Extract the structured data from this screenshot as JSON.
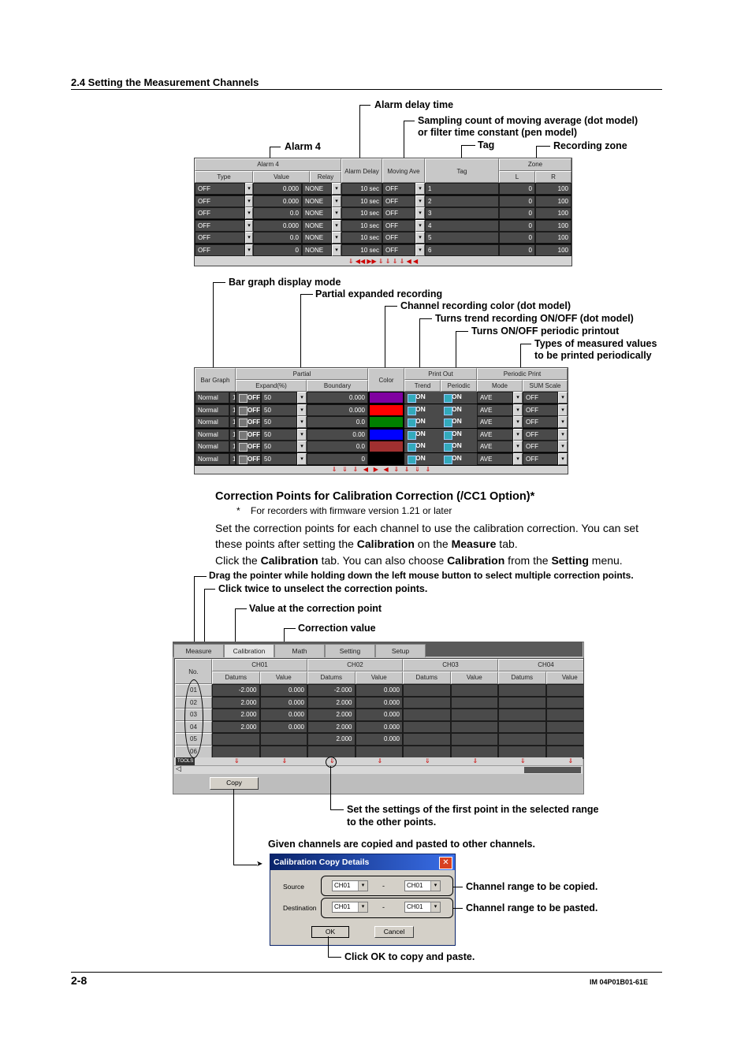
{
  "header": {
    "section": "2.4  Setting the Measurement Channels"
  },
  "fig1": {
    "labels": {
      "alarm_delay": "Alarm delay time",
      "sampling1": "Sampling count of moving average (dot model)",
      "sampling2": "or filter time constant (pen model)",
      "tag": "Tag",
      "zone": "Recording zone",
      "alarm4": "Alarm 4"
    },
    "col_groups": [
      "Alarm 4",
      "Alarm Delay",
      "Moving Ave",
      "Tag",
      "Zone"
    ],
    "col_heads": [
      "Type",
      "Value",
      "Relay",
      "L",
      "R"
    ],
    "rows": [
      {
        "type": "OFF",
        "value": "0.000",
        "relay": "NONE",
        "delay": "10 sec",
        "mave": "OFF",
        "tag": "1",
        "l": "0",
        "r": "100"
      },
      {
        "type": "OFF",
        "value": "0.000",
        "relay": "NONE",
        "delay": "10 sec",
        "mave": "OFF",
        "tag": "2",
        "l": "0",
        "r": "100"
      },
      {
        "type": "OFF",
        "value": "0.0",
        "relay": "NONE",
        "delay": "10 sec",
        "mave": "OFF",
        "tag": "3",
        "l": "0",
        "r": "100"
      },
      {
        "type": "OFF",
        "value": "0.000",
        "relay": "NONE",
        "delay": "10 sec",
        "mave": "OFF",
        "tag": "4",
        "l": "0",
        "r": "100"
      },
      {
        "type": "OFF",
        "value": "0.0",
        "relay": "NONE",
        "delay": "10 sec",
        "mave": "OFF",
        "tag": "5",
        "l": "0",
        "r": "100"
      },
      {
        "type": "OFF",
        "value": "0",
        "relay": "NONE",
        "delay": "10 sec",
        "mave": "OFF",
        "tag": "6",
        "l": "0",
        "r": "100"
      }
    ]
  },
  "fig2": {
    "labels": {
      "bargraph": "Bar graph display mode",
      "partial": "Partial expanded recording",
      "color": "Channel recording color (dot model)",
      "trend": "Turns trend recording ON/OFF (dot model)",
      "periodic": "Turns ON/OFF periodic printout",
      "types1": "Types of measured values",
      "types2": "to be printed periodically"
    },
    "col_groups": [
      "Bar Graph",
      "Partial",
      "Color",
      "Print Out",
      "Periodic Print"
    ],
    "col_heads": [
      "Expand(%)",
      "Boundary",
      "Trend",
      "Periodic",
      "Mode",
      "SUM Scale"
    ],
    "rows": [
      {
        "bar": "Normal",
        "sw": "OFF",
        "expand": "50",
        "boundary": "0.000",
        "color": "#8000a0",
        "trend": "ON",
        "periodic": "ON",
        "mode": "AVE",
        "sum": "OFF"
      },
      {
        "bar": "Normal",
        "sw": "OFF",
        "expand": "50",
        "boundary": "0.000",
        "color": "#ff0000",
        "trend": "ON",
        "periodic": "ON",
        "mode": "AVE",
        "sum": "OFF"
      },
      {
        "bar": "Normal",
        "sw": "OFF",
        "expand": "50",
        "boundary": "0.0",
        "color": "#008000",
        "trend": "ON",
        "periodic": "ON",
        "mode": "AVE",
        "sum": "OFF"
      },
      {
        "bar": "Normal",
        "sw": "OFF",
        "expand": "50",
        "boundary": "0.00",
        "color": "#0000ff",
        "trend": "ON",
        "periodic": "ON",
        "mode": "AVE",
        "sum": "OFF"
      },
      {
        "bar": "Normal",
        "sw": "OFF",
        "expand": "50",
        "boundary": "0.0",
        "color": "#a03030",
        "trend": "ON",
        "periodic": "ON",
        "mode": "AVE",
        "sum": "OFF"
      },
      {
        "bar": "Normal",
        "sw": "OFF",
        "expand": "50",
        "boundary": "0",
        "color": "#000000",
        "trend": "ON",
        "periodic": "ON",
        "mode": "AVE",
        "sum": "OFF"
      }
    ]
  },
  "section": {
    "title": "Correction Points for Calibration Correction (/CC1 Option)*",
    "footnote_mark": "*",
    "footnote": "For recorders with firmware version 1.21 or later",
    "p1": [
      "Set the correction points for each channel to use the calibration correction. You can set",
      "these points after setting the ",
      "Calibration",
      " on the ",
      "Measure",
      " tab."
    ],
    "p2": [
      "Click the ",
      "Calibration",
      " tab. You can also choose ",
      "Calibration",
      " from the ",
      "Setting",
      " menu."
    ]
  },
  "fig3": {
    "labels": {
      "drag": "Drag the pointer while holding down the left mouse button to select multiple correction points.",
      "twice": "Click twice to unselect the correction points.",
      "value_at": "Value at the correction point",
      "corr": "Correction value",
      "first1": "Set the settings of the first point in the selected range",
      "first2": "to the other points.",
      "copied": "Given channels are copied and pasted to other channels.",
      "range_copied": "Channel range to be copied.",
      "range_pasted": "Channel range to be pasted.",
      "ok": "Click OK to copy and paste."
    },
    "tabs": [
      "Measure",
      "Calibration",
      "Math",
      "Setting",
      "Setup"
    ],
    "no_head": "No.",
    "channels": [
      "CH01",
      "CH02",
      "CH03",
      "CH04"
    ],
    "sub_heads": [
      "Datums",
      "Value"
    ],
    "nums": [
      "01",
      "02",
      "03",
      "04",
      "05",
      "06"
    ],
    "ch01": [
      [
        "-2.000",
        "0.000"
      ],
      [
        "2.000",
        "0.000"
      ],
      [
        "2.000",
        "0.000"
      ],
      [
        "2.000",
        "0.000"
      ],
      [
        "",
        ""
      ],
      [
        "",
        ""
      ]
    ],
    "ch02": [
      [
        "-2.000",
        "0.000"
      ],
      [
        "2.000",
        "0.000"
      ],
      [
        "2.000",
        "0.000"
      ],
      [
        "2.000",
        "0.000"
      ],
      [
        "2.000",
        "0.000"
      ],
      [
        "",
        ""
      ]
    ],
    "toolbar_label": "TOOLS",
    "copy_button": "Copy",
    "dialog": {
      "title": "Calibration Copy Details",
      "source": "Source",
      "destination": "Destination",
      "src_from": "CH01",
      "src_to": "CH01",
      "dst_from": "CH01",
      "dst_to": "CH01",
      "dash": "-",
      "ok": "OK",
      "cancel": "Cancel"
    }
  },
  "footer": {
    "page": "2-8",
    "doc": "IM 04P01B01-61E"
  }
}
